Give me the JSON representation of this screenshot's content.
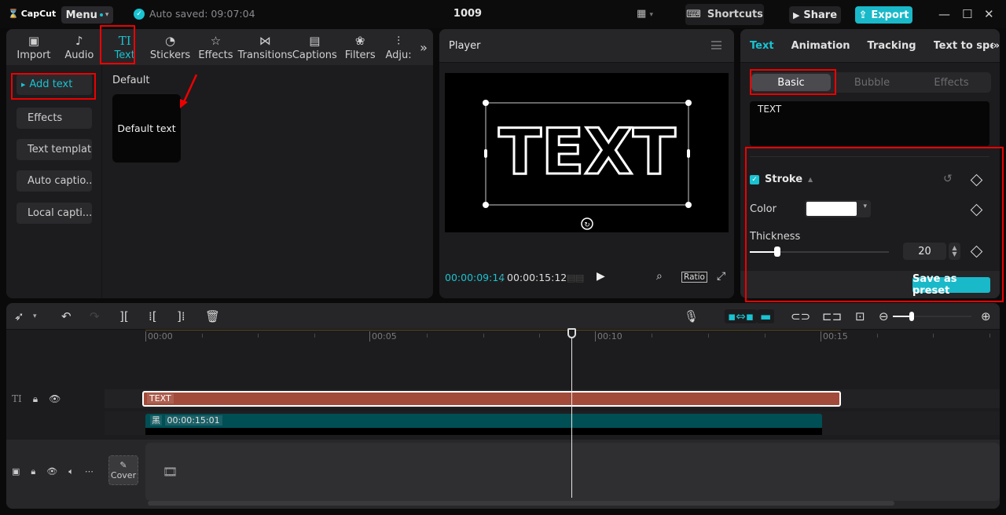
{
  "titlebar": {
    "app_name": "CapCut",
    "menu_label": "Menu",
    "autosave_text": "Auto saved: 09:07:04",
    "project_title": "1009",
    "shortcuts_label": "Shortcuts",
    "share_label": "Share",
    "export_label": "Export",
    "accent_color": "#19c3d1"
  },
  "media_tabs": [
    {
      "label": "Import",
      "icon": "import-icon"
    },
    {
      "label": "Audio",
      "icon": "audio-icon"
    },
    {
      "label": "Text",
      "icon": "text-icon",
      "active": true
    },
    {
      "label": "Stickers",
      "icon": "stickers-icon"
    },
    {
      "label": "Effects",
      "icon": "effects-icon"
    },
    {
      "label": "Transitions",
      "icon": "transitions-icon"
    },
    {
      "label": "Captions",
      "icon": "captions-icon"
    },
    {
      "label": "Filters",
      "icon": "filters-icon"
    },
    {
      "label": "Adju:",
      "icon": "adjust-icon"
    }
  ],
  "text_sidebar": {
    "items": [
      "Add text",
      "Effects",
      "Text template",
      "Auto captio...",
      "Local capti..."
    ]
  },
  "text_library": {
    "section_label": "Default",
    "card_label": "Default text"
  },
  "player": {
    "title": "Player",
    "canvas_text": "TEXT",
    "current_time": "00:00:09:14",
    "separator": "/",
    "total_time": "00:00:15:12",
    "ratio_label": "Ratio"
  },
  "inspector": {
    "tabs": [
      "Text",
      "Animation",
      "Tracking",
      "Text to speech"
    ],
    "subtabs": [
      "Basic",
      "Bubble",
      "Effects"
    ],
    "text_value": "TEXT",
    "stroke": {
      "label": "Stroke",
      "enabled": true,
      "color_label": "Color",
      "color_value": "#ffffff",
      "thickness_label": "Thickness",
      "thickness_value": "20",
      "thickness_fraction": 0.2
    },
    "save_preset_label": "Save as preset"
  },
  "timeline": {
    "ruler_labels": [
      "00:00",
      "00:05",
      "00:10",
      "00:15"
    ],
    "text_clip_label": "TEXT",
    "video_clip_icon": "黑",
    "video_clip_duration": "00:00:15:01",
    "cover_label": "Cover"
  }
}
